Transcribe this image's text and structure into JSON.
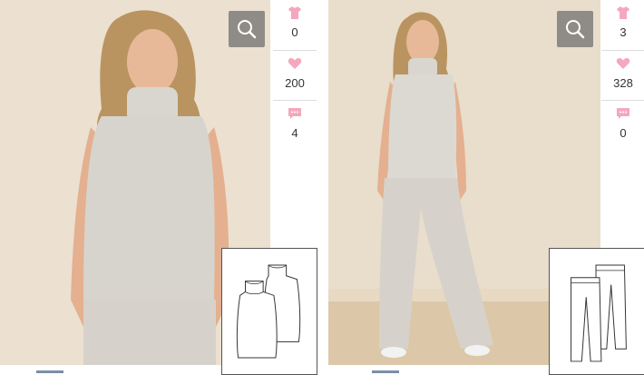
{
  "cards": [
    {
      "stats": {
        "tops": "0",
        "likes": "200",
        "comments": "4"
      }
    },
    {
      "stats": {
        "tops": "3",
        "likes": "328",
        "comments": "0"
      }
    }
  ],
  "colors": {
    "pink": "#f4a7bd",
    "zoom_bg": "#8f8c87",
    "photo_bg": "#e8dccb"
  },
  "icons": {
    "zoom": "magnifier-icon",
    "tops": "tshirt-icon",
    "likes": "heart-icon",
    "comments": "speech-bubble-icon"
  }
}
